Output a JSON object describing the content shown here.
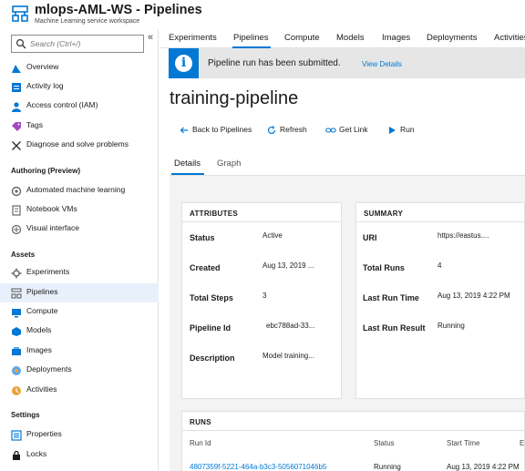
{
  "header": {
    "title": "mlops-AML-WS - Pipelines",
    "subtitle": "Machine Learning service workspace"
  },
  "sidebar": {
    "search_placeholder": "Search (Ctrl+/)",
    "collapse_glyph": "«",
    "items": [
      {
        "label": "Overview",
        "icon": "overview-icon"
      },
      {
        "label": "Activity log",
        "icon": "activity-log-icon"
      },
      {
        "label": "Access control (IAM)",
        "icon": "iam-icon"
      },
      {
        "label": "Tags",
        "icon": "tag-icon"
      },
      {
        "label": "Diagnose and solve problems",
        "icon": "wrench-icon"
      }
    ],
    "section_authoring": "Authoring (Preview)",
    "authoring_items": [
      {
        "label": "Automated machine learning",
        "icon": "automl-icon"
      },
      {
        "label": "Notebook VMs",
        "icon": "notebook-icon"
      },
      {
        "label": "Visual interface",
        "icon": "visual-interface-icon"
      }
    ],
    "section_assets": "Assets",
    "asset_items": [
      {
        "label": "Experiments",
        "icon": "experiments-icon"
      },
      {
        "label": "Pipelines",
        "icon": "pipelines-icon",
        "active": true
      },
      {
        "label": "Compute",
        "icon": "compute-icon"
      },
      {
        "label": "Models",
        "icon": "models-icon"
      },
      {
        "label": "Images",
        "icon": "images-icon"
      },
      {
        "label": "Deployments",
        "icon": "deployments-icon"
      },
      {
        "label": "Activities",
        "icon": "activities-icon"
      }
    ],
    "section_settings": "Settings",
    "settings_items": [
      {
        "label": "Properties",
        "icon": "properties-icon"
      },
      {
        "label": "Locks",
        "icon": "lock-icon"
      }
    ]
  },
  "topnav": {
    "tabs": [
      "Experiments",
      "Pipelines",
      "Compute",
      "Models",
      "Images",
      "Deployments",
      "Activities"
    ],
    "active": "Pipelines"
  },
  "notification": {
    "message": "Pipeline run has been submitted.",
    "link": "View Details"
  },
  "page_title": "training-pipeline",
  "toolbar": {
    "back": "Back to Pipelines",
    "refresh": "Refresh",
    "get_link": "Get Link",
    "run": "Run"
  },
  "subtabs": {
    "details": "Details",
    "graph": "Graph",
    "active": "Details"
  },
  "attributes": {
    "title": "ATTRIBUTES",
    "rows": [
      {
        "label": "Status",
        "value": "Active"
      },
      {
        "label": "Created",
        "value": "Aug 13, 2019 ..."
      },
      {
        "label": "Total Steps",
        "value": "3"
      },
      {
        "label": "Pipeline Id",
        "value": "ebc788ad-33..."
      },
      {
        "label": "Description",
        "value": "Model training..."
      }
    ]
  },
  "summary": {
    "title": "SUMMARY",
    "rows": [
      {
        "label": "URI",
        "value": "https://eastus...."
      },
      {
        "label": "Total Runs",
        "value": "4"
      },
      {
        "label": "Last Run Time",
        "value": "Aug 13, 2019 4:22 PM"
      },
      {
        "label": "Last Run Result",
        "value": "Running"
      }
    ]
  },
  "runs": {
    "title": "RUNS",
    "columns": [
      "Run Id",
      "Status",
      "Start Time",
      "E"
    ],
    "rows": [
      {
        "run_id": "4807359f-5221-464a-b3c3-5056071046b5",
        "status": "Running",
        "start_time": "Aug 13, 2019 4:22 PM"
      }
    ]
  },
  "colors": {
    "accent": "#0078d4",
    "notify_bg": "#e6e6e6",
    "active_nav_bg": "#e8f1fb",
    "content_bg": "#f3f3f3"
  }
}
